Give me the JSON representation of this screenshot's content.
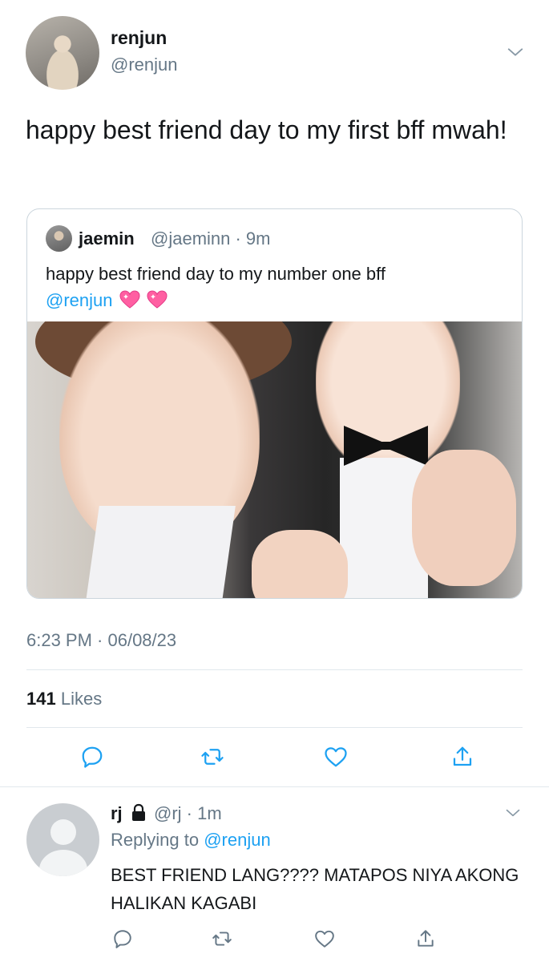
{
  "tweet": {
    "author_name": "renjun",
    "author_handle": "@renjun",
    "text": "happy best friend day to my first bff mwah!",
    "timestamp": "6:23 PM · 06/08/23",
    "likes_count": "141",
    "likes_label": "Likes"
  },
  "quote": {
    "author_name": "jaemin",
    "author_handle": "@jaeminn · 9m",
    "text": "happy best friend day to my number one bff",
    "mention": "@renjun",
    "emoji": [
      "sparkling-heart",
      "sparkling-heart"
    ]
  },
  "reply": {
    "author_name": "rj",
    "author_handle": "@rj · 1m",
    "replying_label": "Replying to",
    "replying_to": "@renjun",
    "text": "BEST FRIEND LANG???? MATAPOS NIYA AKONG HALIKAN KAGABI"
  },
  "actions": [
    "reply-icon",
    "retweet-icon",
    "like-icon",
    "share-icon"
  ],
  "colors": {
    "text": "#14171a",
    "secondary": "#657786",
    "link": "#1da1f2",
    "border": "#e1e8ed",
    "heart": "#ff5fa2"
  }
}
